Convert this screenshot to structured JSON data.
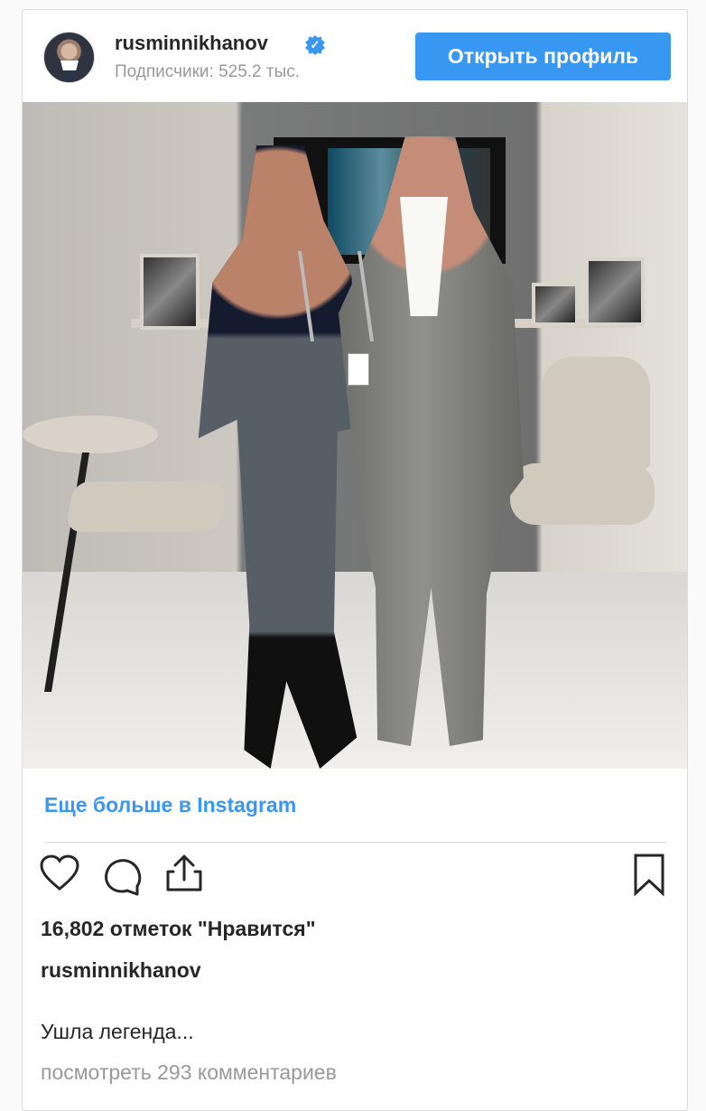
{
  "profile": {
    "username": "rusminnikhanov",
    "verified_icon": "verified-badge",
    "followers": "Подписчики: 525.2 тыс.",
    "open_profile_label": "Открыть профиль"
  },
  "post": {
    "more_link": "Еще больше в Instagram",
    "likes": "16,802 отметок \"Нравится\"",
    "author": "rusminnikhanov",
    "caption": "Ушла легенда...",
    "comments_link": "посмотреть 293 комментариев"
  },
  "icons": {
    "heart": "heart-icon",
    "comment": "comment-icon",
    "share": "share-icon",
    "bookmark": "bookmark-icon"
  },
  "colors": {
    "accent": "#3897f0",
    "text": "#262626",
    "muted": "#999999"
  }
}
